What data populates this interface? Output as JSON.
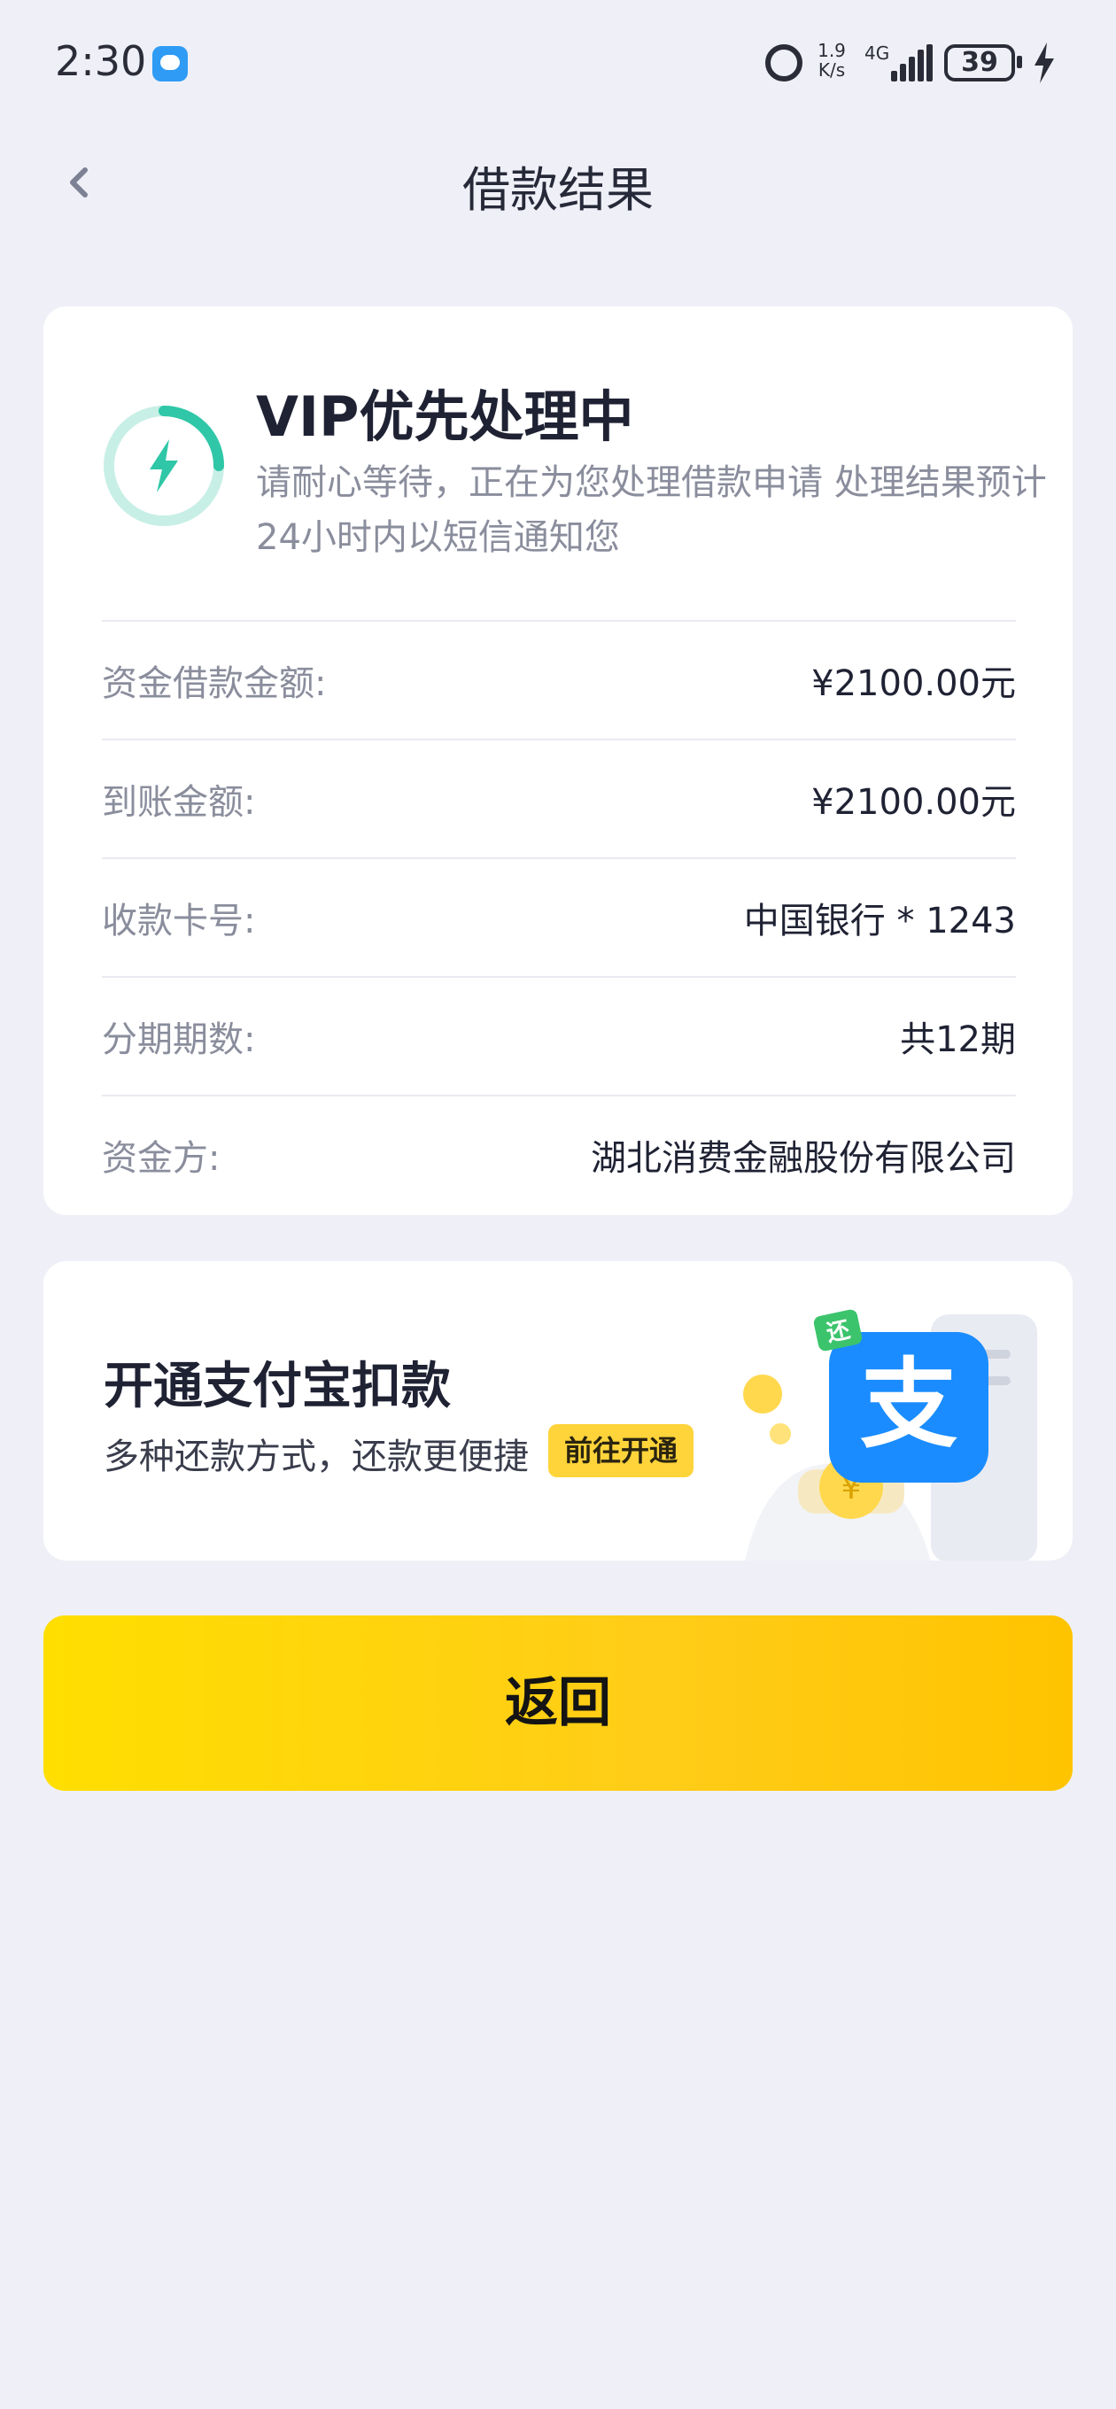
{
  "status_bar": {
    "time": "2:30",
    "net_speed_value": "1.9",
    "net_speed_unit": "K/s",
    "network_type": "4G",
    "battery": "39"
  },
  "nav": {
    "title": "借款结果"
  },
  "result": {
    "title": "VIP优先处理中",
    "description": "请耐心等待，正在为您处理借款申请 处理结果预计24小时内以短信通知您",
    "details": [
      {
        "label": "资金借款金额:",
        "value": "¥2100.00元"
      },
      {
        "label": "到账金额:",
        "value": "¥2100.00元"
      },
      {
        "label": "收款卡号:",
        "value": "中国银行 * 1243"
      },
      {
        "label": "分期期数:",
        "value": "共12期"
      },
      {
        "label": "资金方:",
        "value": "湖北消费金融股份有限公司"
      }
    ]
  },
  "alipay": {
    "title": "开通支付宝扣款",
    "subtitle": "多种还款方式，还款更便捷",
    "button": "前往开通",
    "logo_char": "支",
    "tag_char": "还"
  },
  "actions": {
    "return_label": "返回"
  },
  "colors": {
    "accent_yellow": "#ffd400",
    "status_teal": "#2fc7a7",
    "alipay_blue": "#1a8cff"
  }
}
